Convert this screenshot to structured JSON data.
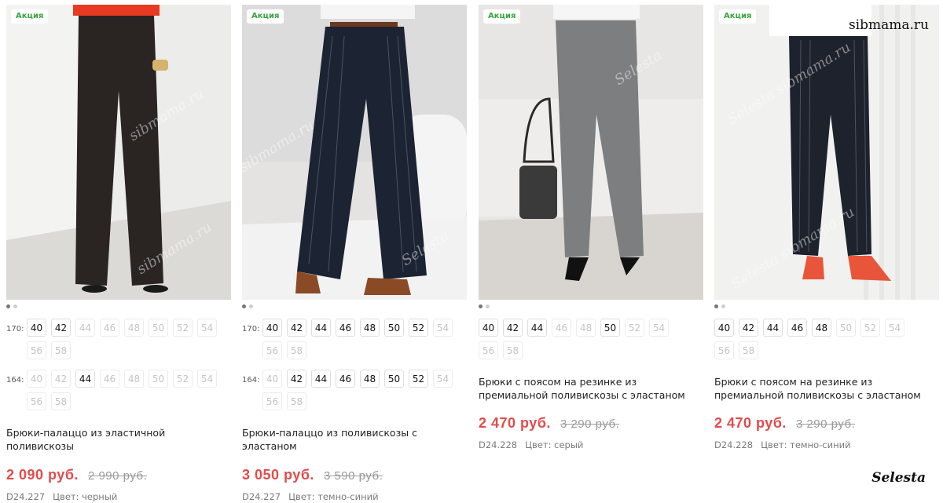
{
  "watermark": {
    "site": "sibmama.ru",
    "brand": "Selesta",
    "mix": "Selesta sibmama.ru"
  },
  "products": [
    {
      "badge": "Акция",
      "title": "Брюки-палаццо из эластичной поливискозы",
      "price": "2 090 руб.",
      "old_price": "2 990 руб.",
      "sku": "D24.227",
      "color_text": "Цвет: черный",
      "size_rows": [
        {
          "label": "170:",
          "sizes": [
            {
              "v": "40",
              "available": true
            },
            {
              "v": "42",
              "available": true
            },
            {
              "v": "44",
              "available": false
            },
            {
              "v": "46",
              "available": false
            },
            {
              "v": "48",
              "available": false
            },
            {
              "v": "50",
              "available": false
            },
            {
              "v": "52",
              "available": false
            },
            {
              "v": "54",
              "available": false
            },
            {
              "v": "56",
              "available": false
            },
            {
              "v": "58",
              "available": false
            }
          ]
        },
        {
          "label": "164:",
          "sizes": [
            {
              "v": "40",
              "available": false
            },
            {
              "v": "42",
              "available": false
            },
            {
              "v": "44",
              "available": true
            },
            {
              "v": "46",
              "available": false
            },
            {
              "v": "48",
              "available": false
            },
            {
              "v": "50",
              "available": false
            },
            {
              "v": "52",
              "available": false
            },
            {
              "v": "54",
              "available": false
            },
            {
              "v": "56",
              "available": false
            },
            {
              "v": "58",
              "available": false
            }
          ]
        }
      ]
    },
    {
      "badge": "Акция",
      "title": "Брюки-палаццо из поливискозы с эластаном",
      "price": "3 050 руб.",
      "old_price": "3 590 руб.",
      "sku": "D24.227",
      "color_text": "Цвет: темно-синий",
      "size_rows": [
        {
          "label": "170:",
          "sizes": [
            {
              "v": "40",
              "available": true
            },
            {
              "v": "42",
              "available": true
            },
            {
              "v": "44",
              "available": true
            },
            {
              "v": "46",
              "available": true
            },
            {
              "v": "48",
              "available": true
            },
            {
              "v": "50",
              "available": true
            },
            {
              "v": "52",
              "available": true
            },
            {
              "v": "54",
              "available": false
            },
            {
              "v": "56",
              "available": false
            },
            {
              "v": "58",
              "available": false
            }
          ]
        },
        {
          "label": "164:",
          "sizes": [
            {
              "v": "40",
              "available": false
            },
            {
              "v": "42",
              "available": true
            },
            {
              "v": "44",
              "available": true
            },
            {
              "v": "46",
              "available": true
            },
            {
              "v": "48",
              "available": true
            },
            {
              "v": "50",
              "available": true
            },
            {
              "v": "52",
              "available": true
            },
            {
              "v": "54",
              "available": false
            },
            {
              "v": "56",
              "available": false
            },
            {
              "v": "58",
              "available": false
            }
          ]
        }
      ]
    },
    {
      "badge": "Акция",
      "title": "Брюки с поясом на резинке из премиальной поливискозы с эластаном",
      "price": "2 470 руб.",
      "old_price": "3 290 руб.",
      "sku": "D24.228",
      "color_text": "Цвет: серый",
      "size_rows": [
        {
          "label": "",
          "sizes": [
            {
              "v": "40",
              "available": true
            },
            {
              "v": "42",
              "available": true
            },
            {
              "v": "44",
              "available": true
            },
            {
              "v": "46",
              "available": false
            },
            {
              "v": "48",
              "available": false
            },
            {
              "v": "50",
              "available": true
            },
            {
              "v": "52",
              "available": false
            },
            {
              "v": "54",
              "available": false
            },
            {
              "v": "56",
              "available": false
            },
            {
              "v": "58",
              "available": false
            }
          ]
        }
      ]
    },
    {
      "badge": "Акция",
      "title": "Брюки с поясом на резинке из премиальной поливискозы с эластаном",
      "price": "2 470 руб.",
      "old_price": "3 290 руб.",
      "sku": "D24.228",
      "color_text": "Цвет: темно-синий",
      "size_rows": [
        {
          "label": "",
          "sizes": [
            {
              "v": "40",
              "available": true
            },
            {
              "v": "42",
              "available": true
            },
            {
              "v": "44",
              "available": true
            },
            {
              "v": "46",
              "available": true
            },
            {
              "v": "48",
              "available": true
            },
            {
              "v": "50",
              "available": false
            },
            {
              "v": "52",
              "available": false
            },
            {
              "v": "54",
              "available": false
            },
            {
              "v": "56",
              "available": false
            },
            {
              "v": "58",
              "available": false
            }
          ]
        }
      ]
    }
  ],
  "photos": [
    {
      "bg": "#ececea",
      "pants": "#2a2523",
      "top": "#e83a22",
      "stripes": false
    },
    {
      "bg": "#e4e3e2",
      "pants": "#1c2433",
      "top": "#f5f5f5",
      "stripes": true
    },
    {
      "bg": "#e8e6e4",
      "pants": "#7d7e80",
      "top": "#f6f6f6",
      "stripes": false
    },
    {
      "bg": "#f1f1f0",
      "pants": "#1e222c",
      "top": "#ffffff",
      "stripes": true
    }
  ]
}
